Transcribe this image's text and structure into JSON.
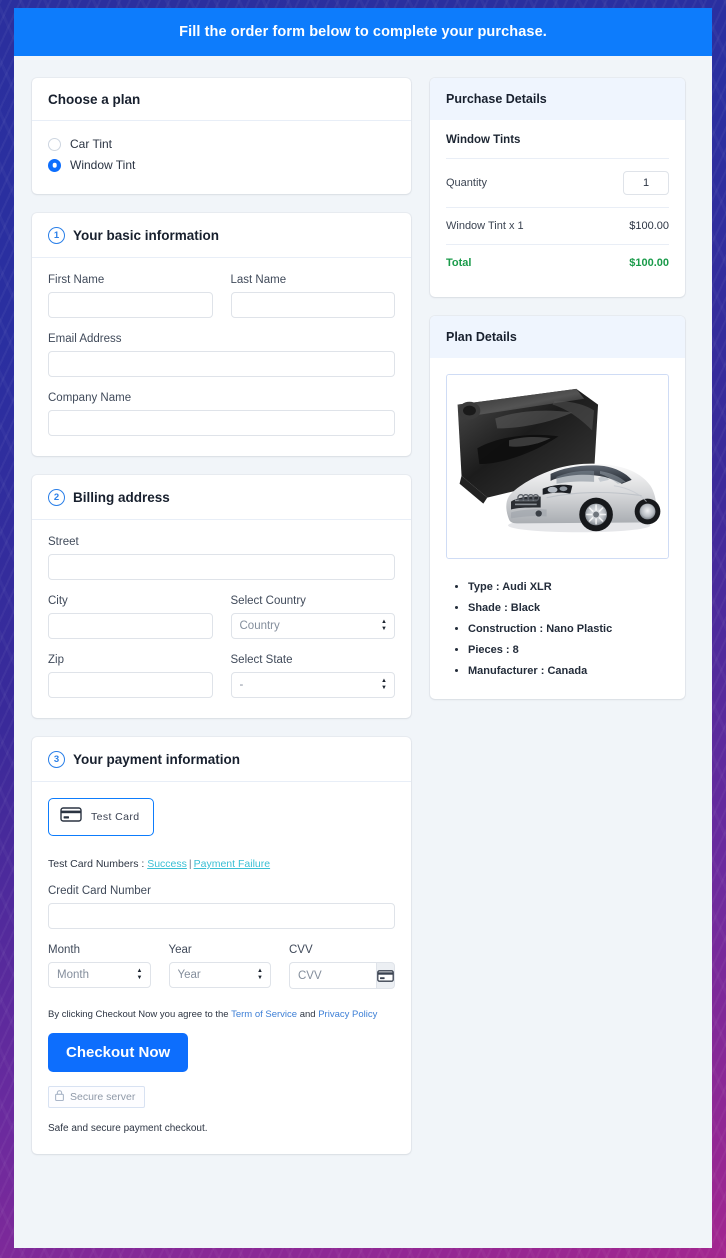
{
  "banner": {
    "text": "Fill the order form below to complete your purchase."
  },
  "plan_card": {
    "title": "Choose a plan",
    "options": [
      {
        "label": "Car Tint",
        "selected": false
      },
      {
        "label": "Window Tint",
        "selected": true
      }
    ]
  },
  "basic_info": {
    "step": "1",
    "title": "Your basic information",
    "first_name_label": "First Name",
    "first_name_value": "",
    "last_name_label": "Last Name",
    "last_name_value": "",
    "email_label": "Email Address",
    "email_value": "",
    "company_label": "Company Name",
    "company_value": ""
  },
  "billing": {
    "step": "2",
    "title": "Billing address",
    "street_label": "Street",
    "street_value": "",
    "city_label": "City",
    "city_value": "",
    "country_label": "Select Country",
    "country_value": "Country",
    "zip_label": "Zip",
    "zip_value": "",
    "state_label": "Select State",
    "state_value": "-"
  },
  "payment": {
    "step": "3",
    "title": "Your payment information",
    "test_card_button": "Test  Card",
    "test_numbers_prefix": "Test Card Numbers : ",
    "test_success_link": "Success",
    "test_separator": "|",
    "test_failure_link": "Payment Failure",
    "card_number_label": "Credit Card Number",
    "card_number_value": "",
    "month_label": "Month",
    "month_value": "Month",
    "year_label": "Year",
    "year_value": "Year",
    "cvv_label": "CVV",
    "cvv_placeholder": "CVV",
    "terms_prefix": "By clicking Checkout Now you agree to the ",
    "terms_link": "Term of Service",
    "terms_middle": " and ",
    "privacy_link": "Privacy Policy",
    "checkout_label": "Checkout Now",
    "secure_badge": "Secure server",
    "safe_note": "Safe and secure payment checkout."
  },
  "purchase_details": {
    "title": "Purchase Details",
    "item_title": "Window Tints",
    "quantity_label": "Quantity",
    "quantity_value": "1",
    "line_label": "Window Tint x 1",
    "line_amount": "$100.00",
    "total_label": "Total",
    "total_amount": "$100.00"
  },
  "plan_details": {
    "title": "Plan Details",
    "image_alt": "window-tint-roll-and-silver-audi-coupe",
    "specs": [
      "Type : Audi XLR",
      "Shade : Black",
      "Construction : Nano Plastic",
      "Pieces : 8",
      "Manufacturer : Canada"
    ]
  },
  "colors": {
    "banner_blue": "#0d7cfc",
    "accent_blue": "#0d6efd",
    "total_green": "#1a9b4a",
    "link_cyan": "#3bbfd4",
    "link_blue": "#3d7fd6",
    "panel_head": "#eff5fe"
  }
}
